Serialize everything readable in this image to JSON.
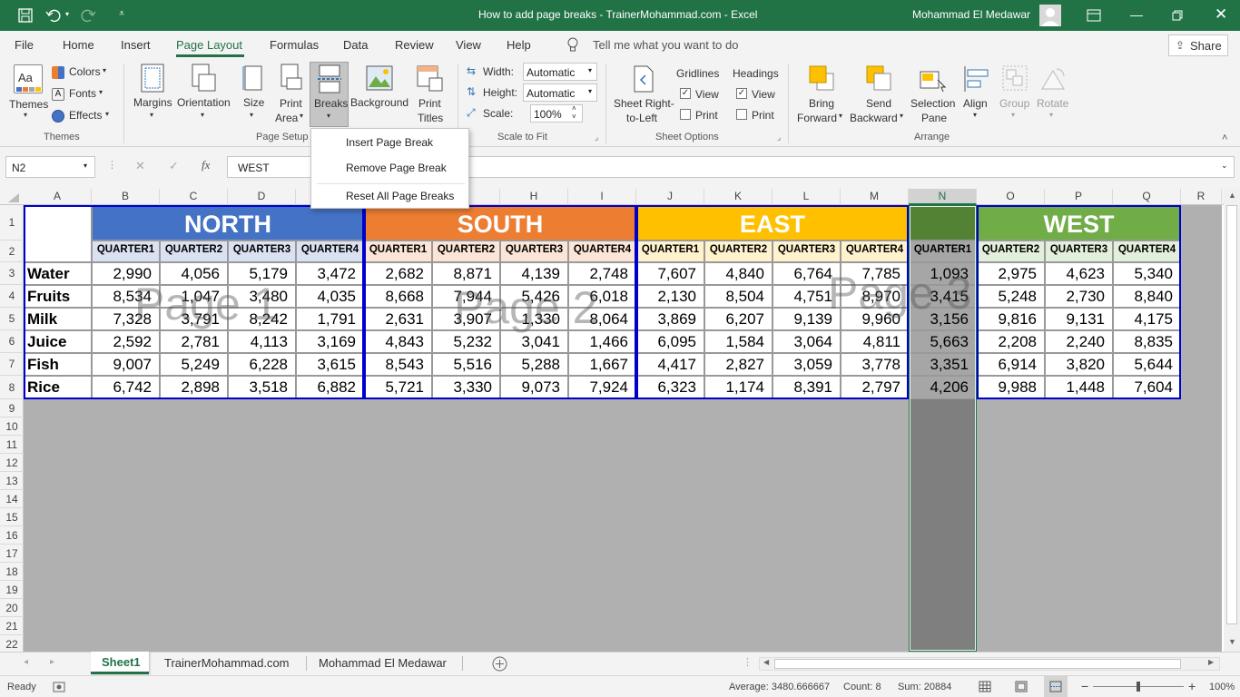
{
  "window": {
    "title": "How to add page breaks - TrainerMohammad.com  -  Excel",
    "user": "Mohammad El Medawar"
  },
  "menu": {
    "tabs": [
      "File",
      "Home",
      "Insert",
      "Page Layout",
      "Formulas",
      "Data",
      "Review",
      "View",
      "Help"
    ],
    "tell_me": "Tell me what you want to do",
    "share": "Share"
  },
  "ribbon": {
    "themes": {
      "themes": "Themes",
      "colors": "Colors",
      "fonts": "Fonts",
      "effects": "Effects",
      "group": "Themes"
    },
    "page_setup": {
      "margins": "Margins",
      "orientation": "Orientation",
      "size": "Size",
      "print_area_1": "Print",
      "print_area_2": "Area",
      "breaks": "Breaks",
      "background": "Background",
      "print_titles_1": "Print",
      "print_titles_2": "Titles",
      "group": "Page Setup"
    },
    "scale": {
      "width_label": "Width:",
      "width_value": "Automatic",
      "height_label": "Height:",
      "height_value": "Automatic",
      "scale_label": "Scale:",
      "scale_value": "100%",
      "group": "Scale to Fit"
    },
    "sheet_options": {
      "sheet_rtl_1": "Sheet Right-",
      "sheet_rtl_2": "to-Left",
      "gridlines": "Gridlines",
      "headings": "Headings",
      "view": "View",
      "print": "Print",
      "group": "Sheet Options"
    },
    "arrange": {
      "bring_forward_1": "Bring",
      "bring_forward_2": "Forward",
      "send_backward_1": "Send",
      "send_backward_2": "Backward",
      "selection_pane_1": "Selection",
      "selection_pane_2": "Pane",
      "align": "Align",
      "group_btn": "Group",
      "rotate": "Rotate",
      "group": "Arrange"
    }
  },
  "breaks_menu": [
    "Insert Page Break",
    "Remove Page Break",
    "Reset All Page Breaks"
  ],
  "formula_bar": {
    "name_box": "N2",
    "formula": "WEST"
  },
  "columns": [
    "A",
    "B",
    "C",
    "D",
    "E",
    "F",
    "G",
    "H",
    "I",
    "J",
    "K",
    "L",
    "M",
    "N",
    "O",
    "P",
    "Q",
    "R"
  ],
  "rows": [
    "1",
    "2",
    "3",
    "4",
    "5",
    "6",
    "7",
    "8",
    "9",
    "10",
    "11",
    "12",
    "13",
    "14",
    "15",
    "16",
    "17",
    "18",
    "19",
    "20",
    "21",
    "22"
  ],
  "regions": [
    {
      "name": "NORTH",
      "color": "#4472c4"
    },
    {
      "name": "SOUTH",
      "color": "#ed7d31"
    },
    {
      "name": "EAST",
      "color": "#ffc000"
    },
    {
      "name": "WEST",
      "color": "#70ad47"
    }
  ],
  "quarter_headers": [
    "QUARTER1",
    "QUARTER2",
    "QUARTER3",
    "QUARTER4"
  ],
  "table": {
    "products": [
      "Water",
      "Fruits",
      "Milk",
      "Juice",
      "Fish",
      "Rice"
    ],
    "values": [
      [
        "2,990",
        "4,056",
        "5,179",
        "3,472",
        "2,682",
        "8,871",
        "4,139",
        "2,748",
        "7,607",
        "4,840",
        "6,764",
        "7,785",
        "1,093",
        "2,975",
        "4,623",
        "5,340"
      ],
      [
        "8,534",
        "1,047",
        "3,480",
        "4,035",
        "8,668",
        "7,944",
        "5,426",
        "6,018",
        "2,130",
        "8,504",
        "4,751",
        "8,970",
        "3,415",
        "5,248",
        "2,730",
        "8,840"
      ],
      [
        "7,328",
        "3,791",
        "8,242",
        "1,791",
        "2,631",
        "3,907",
        "1,330",
        "8,064",
        "3,869",
        "6,207",
        "9,139",
        "9,960",
        "3,156",
        "9,816",
        "9,131",
        "4,175"
      ],
      [
        "2,592",
        "2,781",
        "4,113",
        "3,169",
        "4,843",
        "5,232",
        "3,041",
        "1,466",
        "6,095",
        "1,584",
        "3,064",
        "4,811",
        "5,663",
        "2,208",
        "2,240",
        "8,835"
      ],
      [
        "9,007",
        "5,249",
        "6,228",
        "3,615",
        "8,543",
        "5,516",
        "5,288",
        "1,667",
        "4,417",
        "2,827",
        "3,059",
        "3,778",
        "3,351",
        "6,914",
        "3,820",
        "5,644"
      ],
      [
        "6,742",
        "2,898",
        "3,518",
        "6,882",
        "5,721",
        "3,330",
        "9,073",
        "7,924",
        "6,323",
        "1,174",
        "8,391",
        "2,797",
        "4,206",
        "9,988",
        "1,448",
        "7,604"
      ]
    ]
  },
  "watermarks": [
    "Page 1",
    "Page 2",
    "Page 3"
  ],
  "sheets": [
    "Sheet1",
    "TrainerMohammad.com",
    "Mohammad El Medawar"
  ],
  "status": {
    "ready": "Ready",
    "average": "Average: 3480.666667",
    "count": "Count: 8",
    "sum": "Sum: 20884",
    "zoom": "100%"
  }
}
